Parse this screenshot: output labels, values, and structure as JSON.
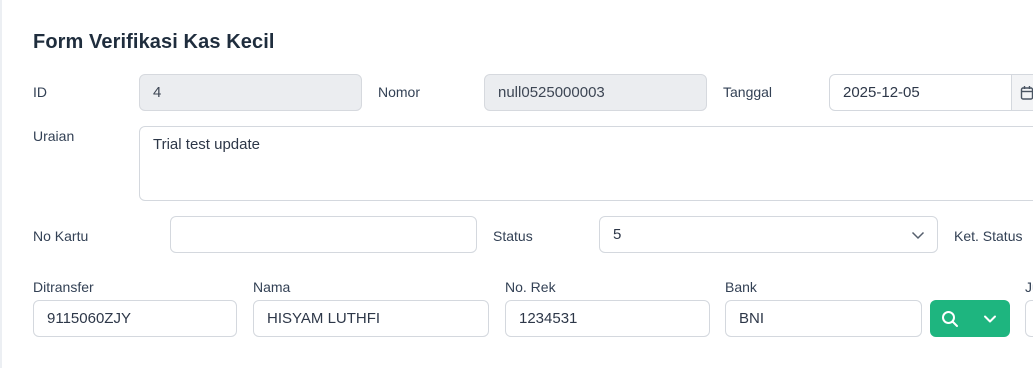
{
  "form": {
    "title": "Form Verifikasi Kas Kecil",
    "id": {
      "label": "ID",
      "value": "4"
    },
    "nomor": {
      "label": "Nomor",
      "value": "null0525000003"
    },
    "tanggal": {
      "label": "Tanggal",
      "value": "2025-12-05",
      "icon": "calendar-icon"
    },
    "uraian": {
      "label": "Uraian",
      "value": "Trial test update"
    },
    "no_kartu": {
      "label": "No Kartu",
      "value": ""
    },
    "status": {
      "label": "Status",
      "value": "5",
      "icon": "chevron-down-icon"
    },
    "ket_status": {
      "label": "Ket. Status"
    },
    "ditransfer": {
      "label": "Ditransfer",
      "value": "9115060ZJY"
    },
    "nama": {
      "label": "Nama",
      "value": "HISYAM LUTHFI"
    },
    "no_rek": {
      "label": "No. Rek",
      "value": "1234531"
    },
    "bank": {
      "label": "Bank",
      "value": "BNI",
      "button_color": "#1eb57f",
      "icons": [
        "search-icon",
        "chevron-down-icon"
      ]
    },
    "cutoff_label": "Ju"
  }
}
